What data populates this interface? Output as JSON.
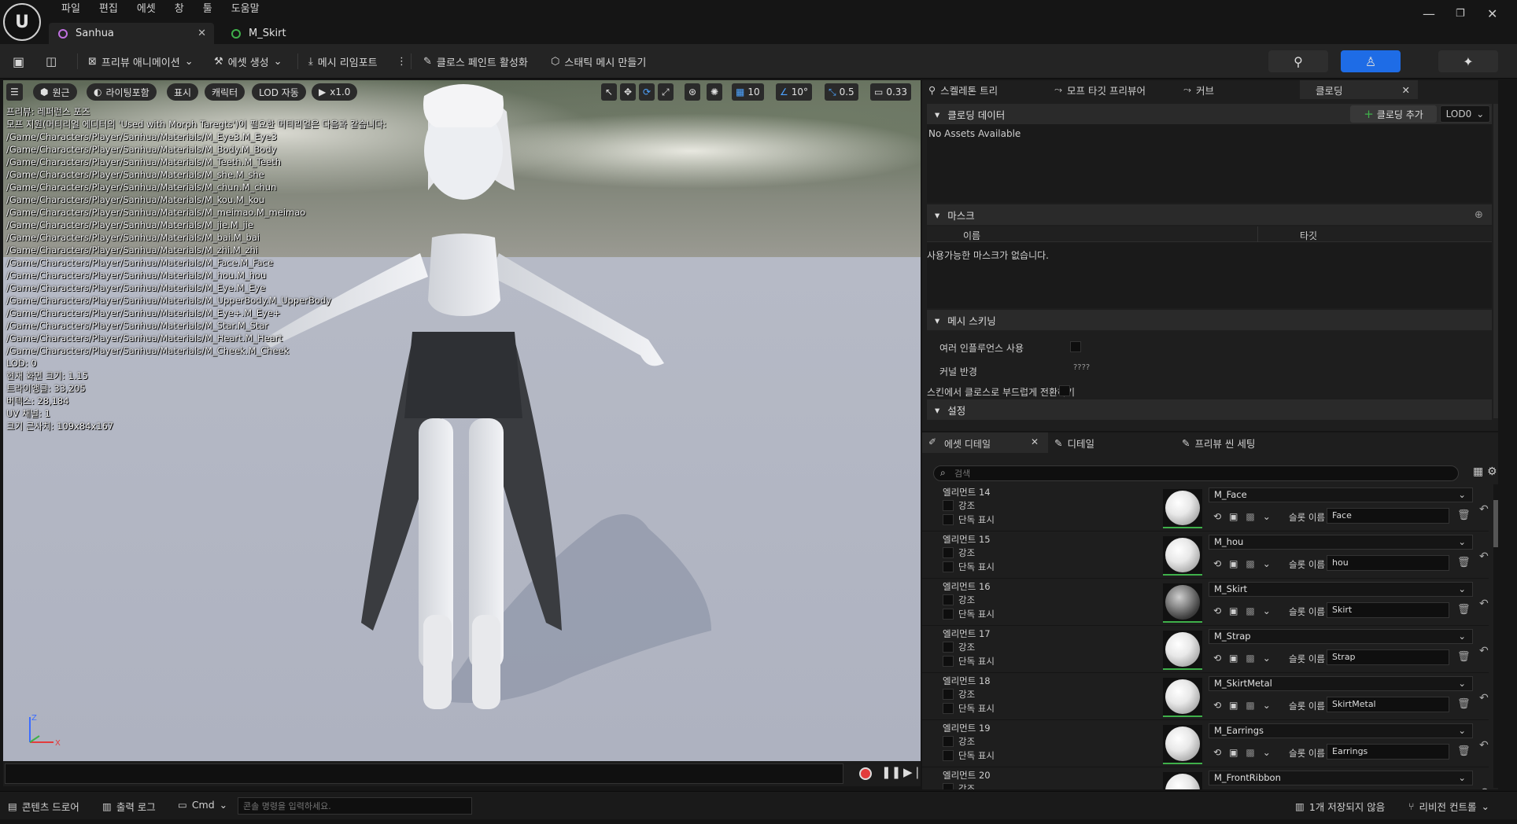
{
  "menu": [
    "파일",
    "편집",
    "에셋",
    "창",
    "툴",
    "도움말"
  ],
  "tabs": [
    {
      "label": "Sanhua"
    },
    {
      "label": "M_Skirt"
    }
  ],
  "toolbar": {
    "preview_anim": "프리뷰 애니메이션",
    "asset_create": "에셋 생성",
    "mesh_reimport": "메시 리임포트",
    "cloth_paint": "클로스 페인트 활성화",
    "static_mesh": "스태틱 메시 만들기"
  },
  "viewport": {
    "perspective": "원근",
    "lighting": "라이팅포함",
    "show": "표시",
    "character": "캐릭터",
    "lod": "LOD 자동",
    "speed": "x1.0",
    "grid": "10",
    "angle": "10°",
    "scale": "0.5",
    "camera": "0.33",
    "overlay_lines": [
      "프리뷰: 레퍼런스 포즈",
      "모프 지원(머티리얼 에디터의 'Used with Morph Taregts')이 필요한 머티리얼은 다음과 같습니다:",
      "/Game/Characters/Player/Sanhua/Materials/M_Eye3.M_Eye3",
      "/Game/Characters/Player/Sanhua/Materials/M_Body.M_Body",
      "/Game/Characters/Player/Sanhua/Materials/M_Teeth.M_Teeth",
      "/Game/Characters/Player/Sanhua/Materials/M_she.M_she",
      "/Game/Characters/Player/Sanhua/Materials/M_chun.M_chun",
      "/Game/Characters/Player/Sanhua/Materials/M_kou.M_kou",
      "/Game/Characters/Player/Sanhua/Materials/M_meimao.M_meimao",
      "/Game/Characters/Player/Sanhua/Materials/M_jie.M_jie",
      "/Game/Characters/Player/Sanhua/Materials/M_bai.M_bai",
      "/Game/Characters/Player/Sanhua/Materials/M_zhi.M_zhi",
      "/Game/Characters/Player/Sanhua/Materials/M_Face.M_Face",
      "/Game/Characters/Player/Sanhua/Materials/M_hou.M_hou",
      "/Game/Characters/Player/Sanhua/Materials/M_Eye.M_Eye",
      "/Game/Characters/Player/Sanhua/Materials/M_UpperBody.M_UpperBody",
      "/Game/Characters/Player/Sanhua/Materials/M_Eye+.M_Eye+",
      "/Game/Characters/Player/Sanhua/Materials/M_Star.M_Star",
      "/Game/Characters/Player/Sanhua/Materials/M_Heart.M_Heart",
      "/Game/Characters/Player/Sanhua/Materials/M_Cheek.M_Cheek",
      "LOD: 0",
      "현재 화면 크기: 1.15",
      "트라이앵글: 33,205",
      "버텍스: 28,184",
      "UV 채널: 1",
      "크기 근사치: 109x84x167"
    ]
  },
  "clothing_panel": {
    "tabs": [
      "스켈레톤 트리",
      "모프 타깃 프리뷰어",
      "커브",
      "클로딩"
    ],
    "clothing_data": "클로딩 데이터",
    "add_clothing": "클로딩 추가",
    "lod": "LOD0",
    "no_assets": "No Assets Available",
    "mask": "마스크",
    "col_name": "이름",
    "col_target": "타깃",
    "no_mask": "사용가능한 마스크가 없습니다.",
    "mesh_skinning": "메시 스키닝",
    "multi_influence": "여러 인플루언스 사용",
    "kernel_radius": "커널 반경",
    "kernel_radius_value": "????",
    "skin_to_cloth": "스킨에서 클로스로 부드럽게 전환하기",
    "settings": "설정"
  },
  "asset_details": {
    "tabs": [
      "에셋 디테일",
      "디테일",
      "프리뷰 씬 세팅"
    ],
    "search_placeholder": "검색",
    "highlight": "강조",
    "isolate": "단독 표시",
    "slot_name": "슬롯 이름",
    "elements": [
      {
        "name": "엘리먼트 14",
        "material": "M_Face",
        "slot": "Face"
      },
      {
        "name": "엘리먼트 15",
        "material": "M_hou",
        "slot": "hou"
      },
      {
        "name": "엘리먼트 16",
        "material": "M_Skirt",
        "slot": "Skirt"
      },
      {
        "name": "엘리먼트 17",
        "material": "M_Strap",
        "slot": "Strap"
      },
      {
        "name": "엘리먼트 18",
        "material": "M_SkirtMetal",
        "slot": "SkirtMetal"
      },
      {
        "name": "엘리먼트 19",
        "material": "M_Earrings",
        "slot": "Earrings"
      },
      {
        "name": "엘리먼트 20",
        "material": "M_FrontRibbon",
        "slot": ""
      }
    ]
  },
  "statusbar": {
    "content_drawer": "콘텐츠 드로어",
    "output_log": "출력 로그",
    "cmd": "Cmd",
    "cmd_placeholder": "콘솔 명령을 입력하세요.",
    "unsaved": "1개 저장되지 않음",
    "revision": "리비전 컨트롤"
  },
  "colors": {
    "accent": "#1e6ce6",
    "record": "#e23c3c",
    "green": "#3fb04a"
  }
}
